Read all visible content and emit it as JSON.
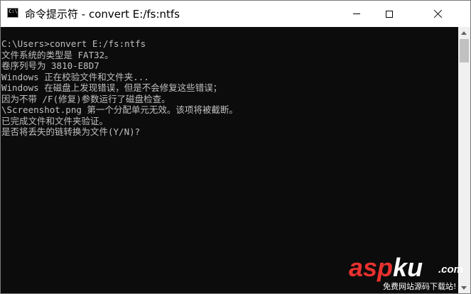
{
  "window": {
    "title": "命令提示符 - convert  E:/fs:ntfs",
    "app_icon_text": "C:\\",
    "icons": {
      "app": "cmd-icon",
      "minimize": "minimize-icon",
      "maximize": "maximize-icon",
      "close": "close-icon"
    }
  },
  "console": {
    "foreground": "#c0c0c0",
    "background": "#0c0c0c",
    "lines": [
      "C:\\Users>convert E:/fs:ntfs",
      "文件系统的类型是 FAT32。",
      "卷序列号为 3810-E8D7",
      "Windows 正在校验文件和文件夹...",
      "Windows 在磁盘上发现错误，但是不会修复这些错误；",
      "因为不带 /F(修复)参数运行了磁盘检查。",
      "\\Screenshot.png 第一个分配单元无效。该项将被截断。",
      "已完成文件和文件夹验证。",
      "是否将丢失的链转换为文件(Y/N)?"
    ]
  },
  "watermark": {
    "brand_red": "asp",
    "brand_white": "ku",
    "tld": ".com",
    "subtitle": "免费网站源码下载站!",
    "colors": {
      "red": "#e8312f",
      "white": "#ffffff"
    }
  }
}
